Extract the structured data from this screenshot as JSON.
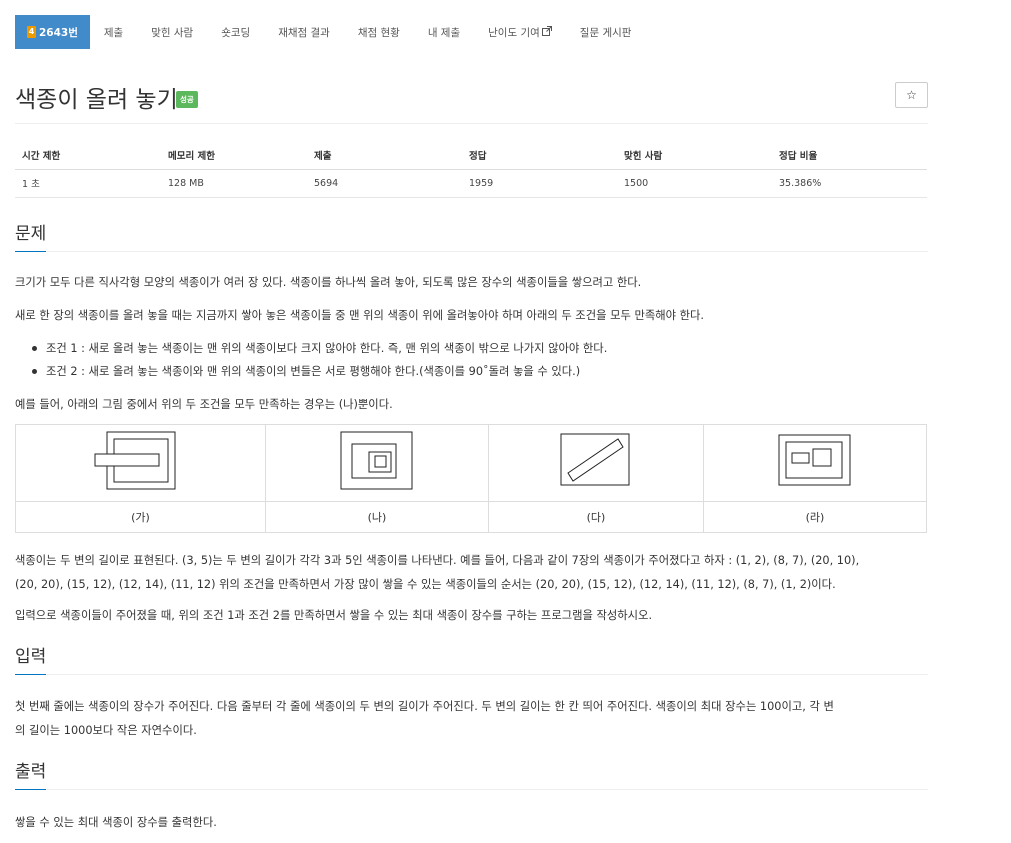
{
  "nav": {
    "tier": "4",
    "problem_number": "2643번",
    "submit": "제출",
    "solved_users": "맞힌 사람",
    "short_coding": "숏코딩",
    "rejudge": "재채점 결과",
    "status": "채점 현황",
    "my_submissions": "내 제출",
    "difficulty": "난이도 기여",
    "board": "질문 게시판"
  },
  "problem": {
    "title": "색종이 올려 놓기",
    "badge": "성공",
    "star": "☆"
  },
  "info_table": {
    "headers": [
      "시간 제한",
      "메모리 제한",
      "제출",
      "정답",
      "맞힌 사람",
      "정답 비율"
    ],
    "values": [
      "1 초",
      "128 MB",
      "5694",
      "1959",
      "1500",
      "35.386%"
    ]
  },
  "sections": {
    "problem": "문제",
    "input": "입력",
    "output": "출력"
  },
  "description": {
    "p1": "크기가 모두 다른 직사각형 모양의 색종이가 여러 장 있다. 색종이를 하나씩 올려 놓아, 되도록 많은 장수의 색종이들을 쌓으려고 한다.",
    "p2": "새로 한 장의 색종이를 올려 놓을 때는 지금까지 쌓아 놓은 색종이들 중 맨 위의 색종이 위에 올려놓아야 하며 아래의 두 조건을 모두 만족해야 한다.",
    "bullets": [
      "조건 1 : 새로 올려 놓는 색종이는 맨 위의 색종이보다 크지 않아야 한다. 즉, 맨 위의 색종이 밖으로 나가지 않아야 한다.",
      "조건 2 : 새로 올려 놓는 색종이와 맨 위의 색종이의 변들은 서로 평행해야 한다.(색종이를 90˚돌려 놓을 수 있다.)"
    ],
    "p3": "예를 들어, 아래의 그림 중에서 위의 두 조건을 모두 만족하는 경우는 (나)뿐이다.",
    "figure_labels": [
      "(가)",
      "(나)",
      "(다)",
      "(라)"
    ],
    "p4_line1": "색종이는 두 변의 길이로 표현된다. (3, 5)는 두 변의 길이가 각각 3과 5인 색종이를 나타낸다. 예를 들어, 다음과 같이 7장의 색종이가 주어졌다고 하자 : (1, 2), (8, 7), (20, 10),",
    "p4_line2": "(20, 20), (15, 12), (12, 14), (11, 12) 위의 조건을 만족하면서 가장 많이 쌓을 수 있는 색종이들의 순서는 (20, 20), (15, 12), (12, 14), (11, 12), (8, 7), (1, 2)이다.",
    "p5": "입력으로 색종이들이 주어졌을 때, 위의 조건 1과 조건 2를 만족하면서 쌓을 수 있는 최대 색종이 장수를 구하는 프로그램을 작성하시오."
  },
  "input": {
    "line1": "첫 번째 줄에는 색종이의 장수가 주어진다. 다음 줄부터 각 줄에 색종이의 두 변의 길이가 주어진다. 두 변의 길이는 한 칸 띄어 주어진다. 색종이의 최대 장수는 100이고, 각 변",
    "line2": "의 길이는 1000보다 작은 자연수이다."
  },
  "output": {
    "line1": "쌓을 수 있는 최대 색종이 장수를 출력한다."
  },
  "colors": {
    "nav_active": "#428bca",
    "tier": "#ec9a00",
    "badge": "#5cb85c",
    "section_underline": "#0076c0"
  }
}
